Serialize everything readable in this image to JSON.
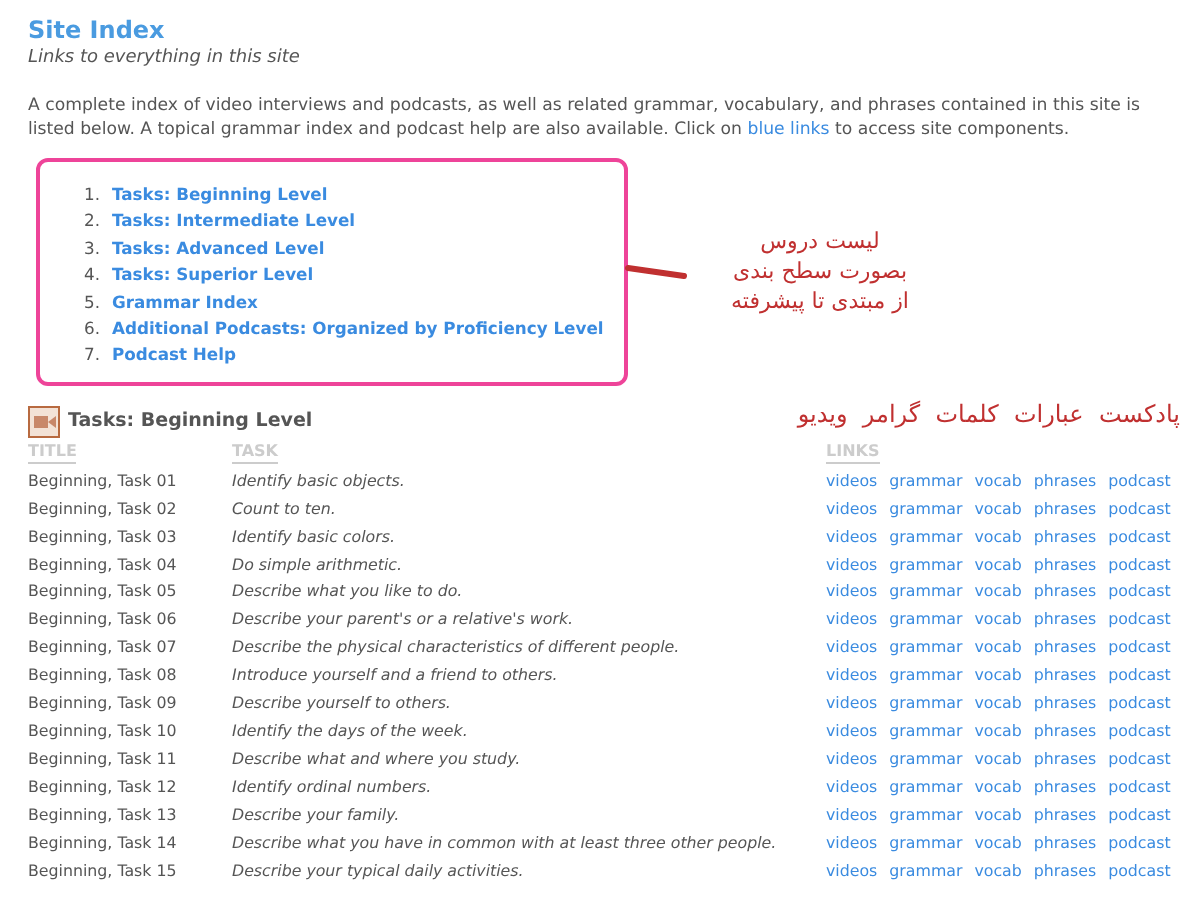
{
  "header": {
    "title": "Site Index",
    "subtitle": "Links to everything in this site"
  },
  "intro": {
    "text": "A complete index of video interviews and podcasts, as well as related grammar, vocabulary, and phrases contained in this site is listed below.  A topical grammar index and podcast help are also available.  Click on ",
    "link": "blue links",
    "after": " to access site components."
  },
  "toc": [
    {
      "number": "1.",
      "label": "Tasks: Beginning Level"
    },
    {
      "number": "2.",
      "label": "Tasks: Intermediate Level"
    },
    {
      "number": "3.",
      "label": "Tasks: Advanced Level"
    },
    {
      "number": "4.",
      "label": "Tasks: Superior Level"
    },
    {
      "number": "5.",
      "label": "Grammar Index"
    },
    {
      "number": "6.",
      "label": "Additional Podcasts: Organized by Proficiency Level"
    },
    {
      "number": "7.",
      "label": "Podcast Help"
    }
  ],
  "annotations": {
    "toc_note": [
      "لیست دروس",
      "بصورت سطح بندی",
      "از مبتدی تا پیشرفته"
    ],
    "links_note": "پادکست  عبارات  کلمات  گرامر  ویدیو"
  },
  "section": {
    "title": "Tasks: Beginning Level",
    "columns": [
      "TITLE",
      "TASK",
      "LINKS"
    ],
    "rows": [
      {
        "title": "Beginning, Task 01",
        "task": "Identify basic objects.",
        "links": [
          "videos",
          "grammar",
          "vocab",
          "phrases",
          "podcast"
        ]
      },
      {
        "title": "Beginning, Task 02",
        "task": "Count to ten.",
        "links": [
          "videos",
          "grammar",
          "vocab",
          "phrases",
          "podcast"
        ]
      },
      {
        "title": "Beginning, Task 03",
        "task": "Identify basic colors.",
        "links": [
          "videos",
          "grammar",
          "vocab",
          "phrases",
          "podcast"
        ]
      },
      {
        "title": "Beginning, Task 04",
        "task": "Do simple arithmetic.",
        "links": [
          "videos",
          "grammar",
          "vocab",
          "phrases",
          "podcast"
        ]
      },
      {
        "title": "Beginning, Task 05",
        "task": "Describe what you like to do.",
        "links": [
          "videos",
          "grammar",
          "vocab",
          "phrases",
          "podcast"
        ]
      },
      {
        "title": "Beginning, Task 06",
        "task": "Describe your parent's or a relative's work.",
        "links": [
          "videos",
          "grammar",
          "vocab",
          "phrases",
          "podcast"
        ]
      },
      {
        "title": "Beginning, Task 07",
        "task": "Describe the physical characteristics of different people.",
        "links": [
          "videos",
          "grammar",
          "vocab",
          "phrases",
          "podcast"
        ]
      },
      {
        "title": "Beginning, Task 08",
        "task": "Introduce yourself and a friend to others.",
        "links": [
          "videos",
          "grammar",
          "vocab",
          "phrases",
          "podcast"
        ]
      },
      {
        "title": "Beginning, Task 09",
        "task": "Describe yourself to others.",
        "links": [
          "videos",
          "grammar",
          "vocab",
          "phrases",
          "podcast"
        ]
      },
      {
        "title": "Beginning, Task 10",
        "task": "Identify the days of the week.",
        "links": [
          "videos",
          "grammar",
          "vocab",
          "phrases",
          "podcast"
        ]
      },
      {
        "title": "Beginning, Task 11",
        "task": "Describe what and where you study.",
        "links": [
          "videos",
          "grammar",
          "vocab",
          "phrases",
          "podcast"
        ]
      },
      {
        "title": "Beginning, Task 12",
        "task": "Identify ordinal numbers.",
        "links": [
          "videos",
          "grammar",
          "vocab",
          "phrases",
          "podcast"
        ]
      },
      {
        "title": "Beginning, Task 13",
        "task": "Describe your family.",
        "links": [
          "videos",
          "grammar",
          "vocab",
          "phrases",
          "podcast"
        ]
      },
      {
        "title": "Beginning, Task 14",
        "task": "Describe what you have in common with at least three other people.",
        "links": [
          "videos",
          "grammar",
          "vocab",
          "phrases",
          "podcast"
        ]
      },
      {
        "title": "Beginning, Task 15",
        "task": "Describe your typical daily activities.",
        "links": [
          "videos",
          "grammar",
          "vocab",
          "phrases",
          "podcast"
        ]
      }
    ]
  }
}
